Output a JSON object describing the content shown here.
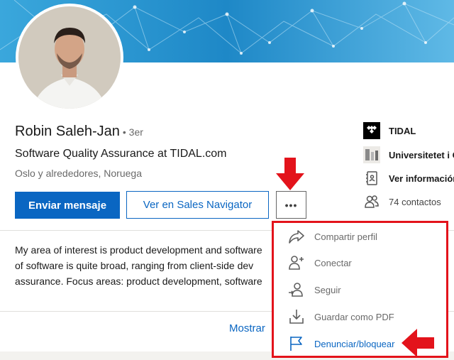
{
  "colors": {
    "brand_blue": "#0a66c2",
    "banner_blue": "#2b9bd6",
    "annotation_red": "#e3131b"
  },
  "profile": {
    "name": "Robin Saleh-Jan",
    "degree": "• 3er",
    "headline": "Software Quality Assurance at TIDAL.com",
    "location": "Oslo y alrededores, Noruega"
  },
  "actions": {
    "message_label": "Enviar mensaje",
    "sales_navigator_label": "Ver en Sales Navigator",
    "more_label": "•••"
  },
  "summary": {
    "lines": [
      "My area of interest is product development and software",
      "of software is quite broad, ranging from client-side dev",
      "assurance. Focus areas: product development, software"
    ]
  },
  "show_more_label": "Mostrar",
  "sidebar": {
    "items": [
      {
        "label": "TIDAL",
        "icon": "tidal-logo-icon"
      },
      {
        "label": "Universitetet i O",
        "icon": "university-logo-icon"
      },
      {
        "label": "Ver información",
        "icon": "contact-card-icon"
      },
      {
        "label": "74 contactos",
        "icon": "connections-icon"
      }
    ]
  },
  "more_menu": {
    "items": [
      {
        "label": "Compartir perfil",
        "icon": "share-arrow-icon"
      },
      {
        "label": "Conectar",
        "icon": "add-person-icon"
      },
      {
        "label": "Seguir",
        "icon": "follow-person-icon"
      },
      {
        "label": "Guardar como PDF",
        "icon": "download-icon"
      },
      {
        "label": "Denunciar/bloquear",
        "icon": "flag-icon"
      }
    ]
  }
}
